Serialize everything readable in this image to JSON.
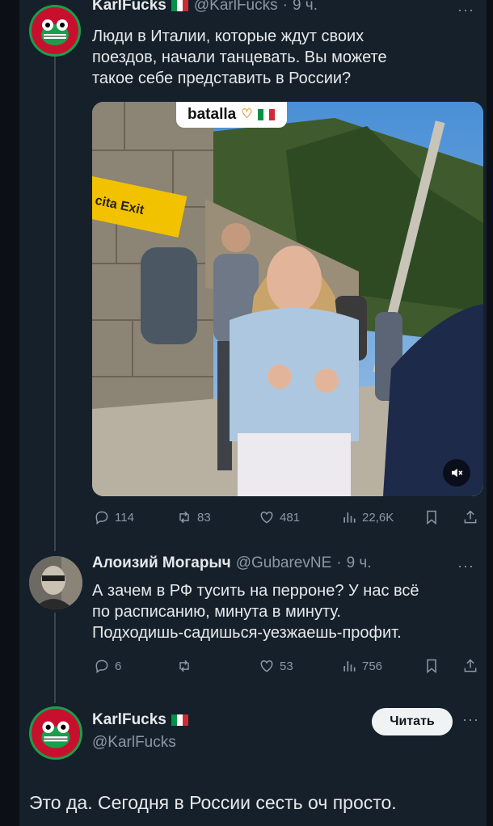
{
  "tweet1": {
    "name": "KarlFucks",
    "handle": "@KarlFucks",
    "time": "9 ч.",
    "lines": [
      "Люди в Италии, которые ждут своих",
      "поездов, начали танцевать. Вы можете",
      "такое себе представить в России?"
    ],
    "video": {
      "overlay_text": "batalla",
      "sign_text": "cita Exit"
    },
    "stats": {
      "replies": "114",
      "retweets": "83",
      "likes": "481",
      "views": "22,6K"
    }
  },
  "tweet2": {
    "name": "Алоизий Могарыч",
    "handle": "@GubarevNE",
    "time": "9 ч.",
    "lines": [
      "А зачем в РФ тусить на перроне? У нас всё",
      "по расписанию, минута в минуту.",
      "Подходишь-садишься-уезжаешь-профит."
    ],
    "stats": {
      "replies": "6",
      "retweets": "",
      "likes": "53",
      "views": "756"
    }
  },
  "tweet3": {
    "name": "KarlFucks",
    "handle": "@KarlFucks",
    "follow_label": "Читать",
    "text": "Это да. Сегодня в  России  сесть оч просто."
  },
  "colors": {
    "background": "#15202b",
    "text": "#e7e9ea",
    "muted": "#8b98a5",
    "italy_green": "#009246",
    "italy_red": "#ce2b37"
  },
  "icons": [
    "reply-icon",
    "retweet-icon",
    "like-icon",
    "views-icon",
    "bookmark-icon",
    "share-icon",
    "mute-icon",
    "more-icon"
  ]
}
